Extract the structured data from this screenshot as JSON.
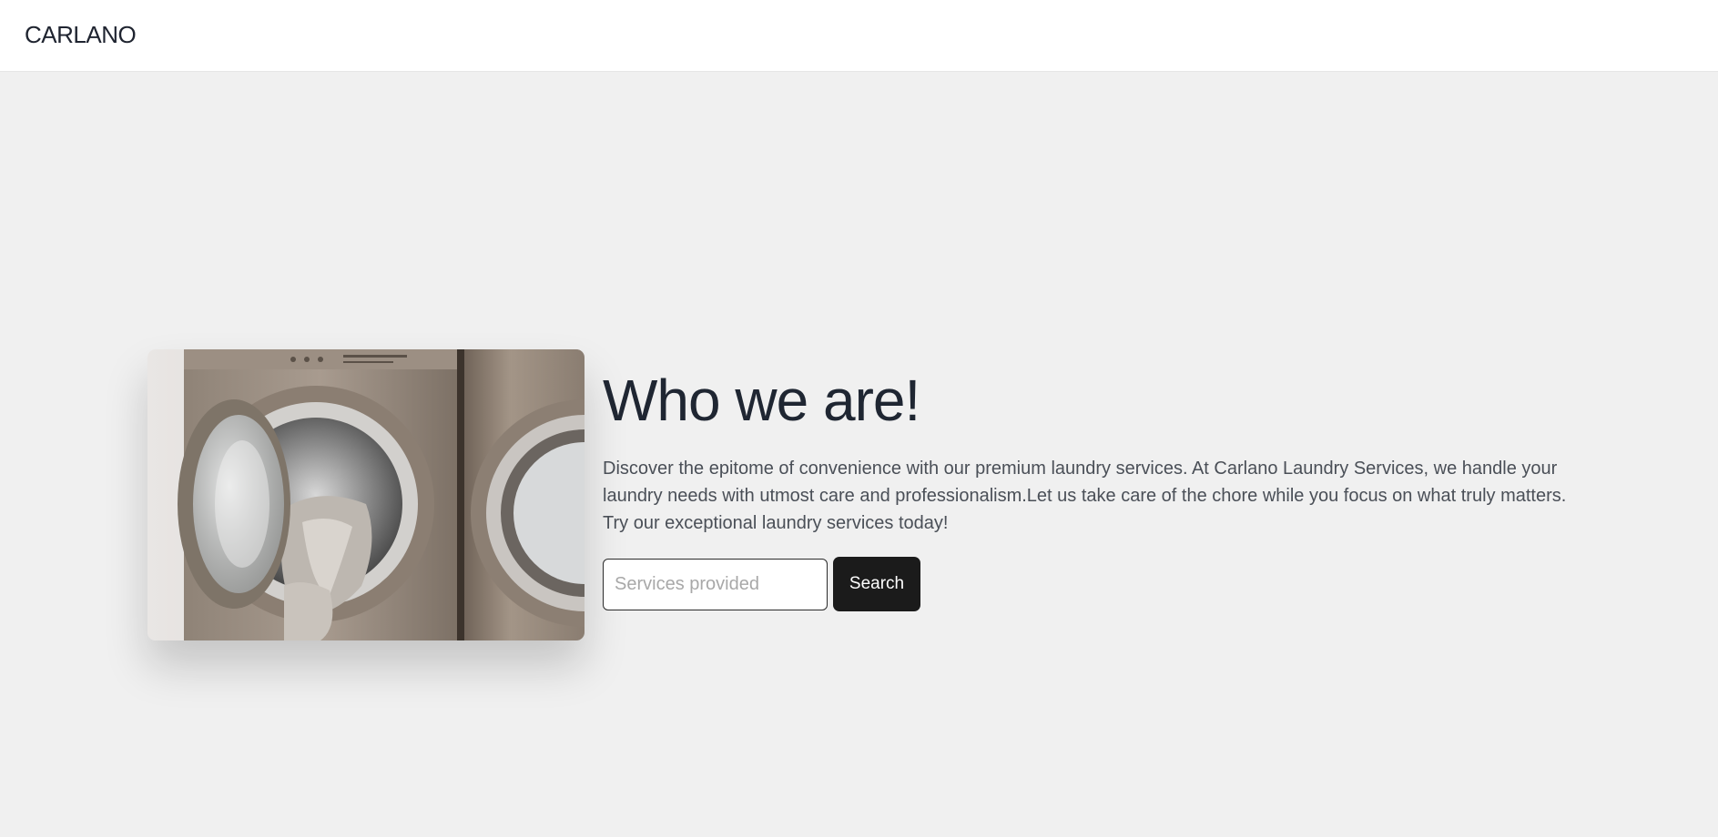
{
  "nav": {
    "brand": "CARLANO"
  },
  "hero": {
    "image_alt": "washing-machine-with-laundry",
    "title": "Who we are!",
    "description": "Discover the epitome of convenience with our premium laundry services. At Carlano Laundry Services, we handle your laundry needs with utmost care and professionalism.Let us take care of the chore while you focus on what truly matters. Try our exceptional laundry services today!",
    "search": {
      "placeholder": "Services provided",
      "value": "",
      "button_label": "Search"
    }
  },
  "colors": {
    "background": "#f0f0f0",
    "navbar": "#ffffff",
    "button": "#1b1b1b",
    "title": "#1f2632"
  }
}
